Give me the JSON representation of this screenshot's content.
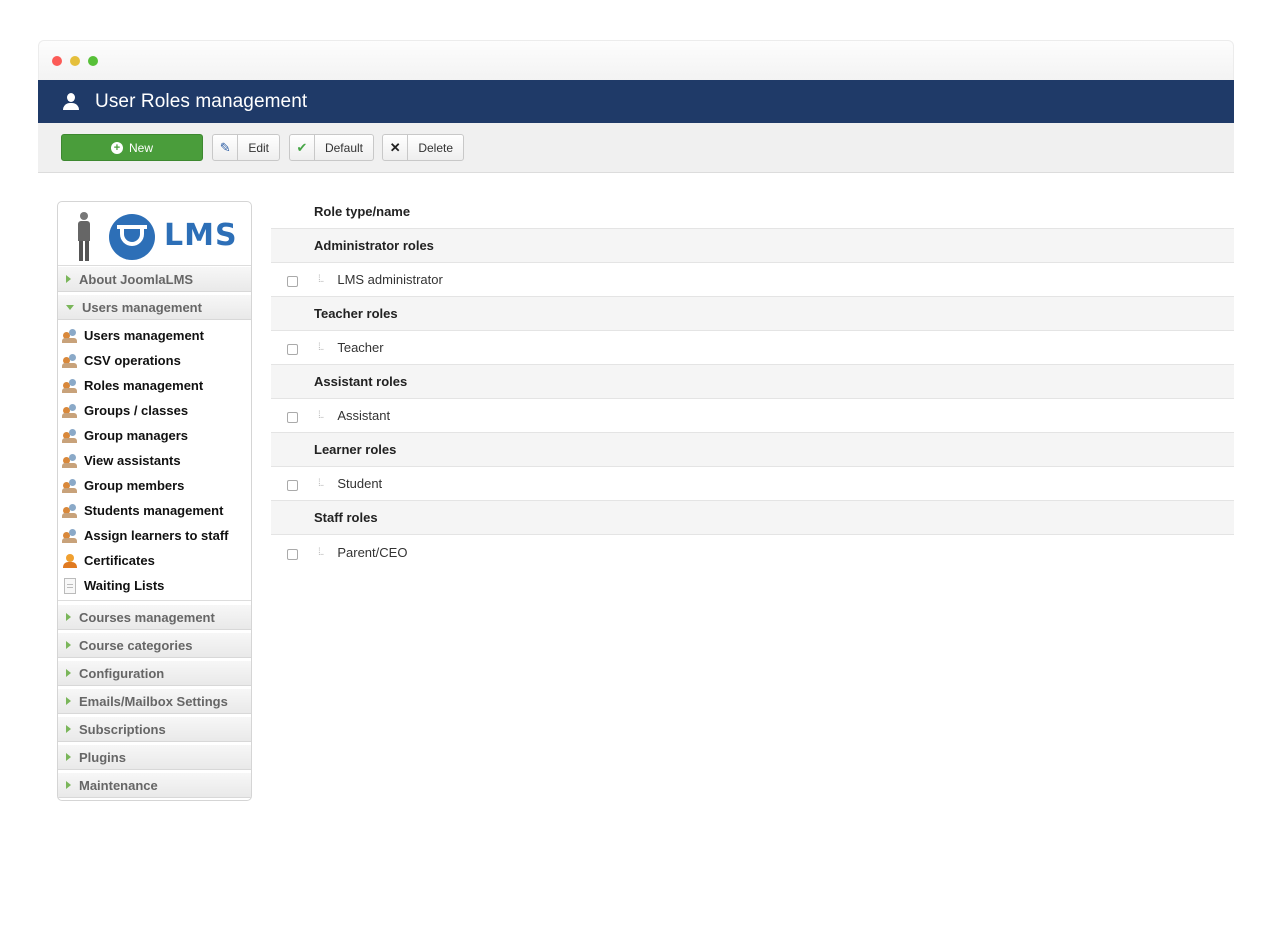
{
  "header": {
    "title": "User Roles management",
    "icon": "user-icon"
  },
  "toolbar": {
    "new_label": "New",
    "edit_label": "Edit",
    "default_label": "Default",
    "delete_label": "Delete",
    "new_color": "#4a9d3b"
  },
  "sidebar": {
    "logo_text": "LMS",
    "about": "About JoomlaLMS",
    "users_section": "Users management",
    "items": [
      {
        "label": "Users management",
        "icon": "users-icon"
      },
      {
        "label": "CSV operations",
        "icon": "users-icon"
      },
      {
        "label": "Roles management",
        "icon": "users-icon"
      },
      {
        "label": "Groups / classes",
        "icon": "users-icon"
      },
      {
        "label": "Group managers",
        "icon": "users-icon"
      },
      {
        "label": "View assistants",
        "icon": "users-icon"
      },
      {
        "label": "Group members",
        "icon": "users-icon"
      },
      {
        "label": "Students management",
        "icon": "users-icon"
      },
      {
        "label": "Assign learners to staff",
        "icon": "users-icon"
      },
      {
        "label": "Certificates",
        "icon": "certificate-icon"
      },
      {
        "label": "Waiting Lists",
        "icon": "document-icon"
      }
    ],
    "sections": [
      "Courses management",
      "Course categories",
      "Configuration",
      "Emails/Mailbox Settings",
      "Subscriptions",
      "Plugins",
      "Maintenance"
    ]
  },
  "table": {
    "header": "Role type/name",
    "groups": [
      {
        "name": "Administrator roles",
        "role": "LMS administrator"
      },
      {
        "name": "Teacher roles",
        "role": "Teacher"
      },
      {
        "name": "Assistant roles",
        "role": "Assistant"
      },
      {
        "name": "Learner roles",
        "role": "Student"
      },
      {
        "name": "Staff roles",
        "role": "Parent/CEO"
      }
    ]
  }
}
